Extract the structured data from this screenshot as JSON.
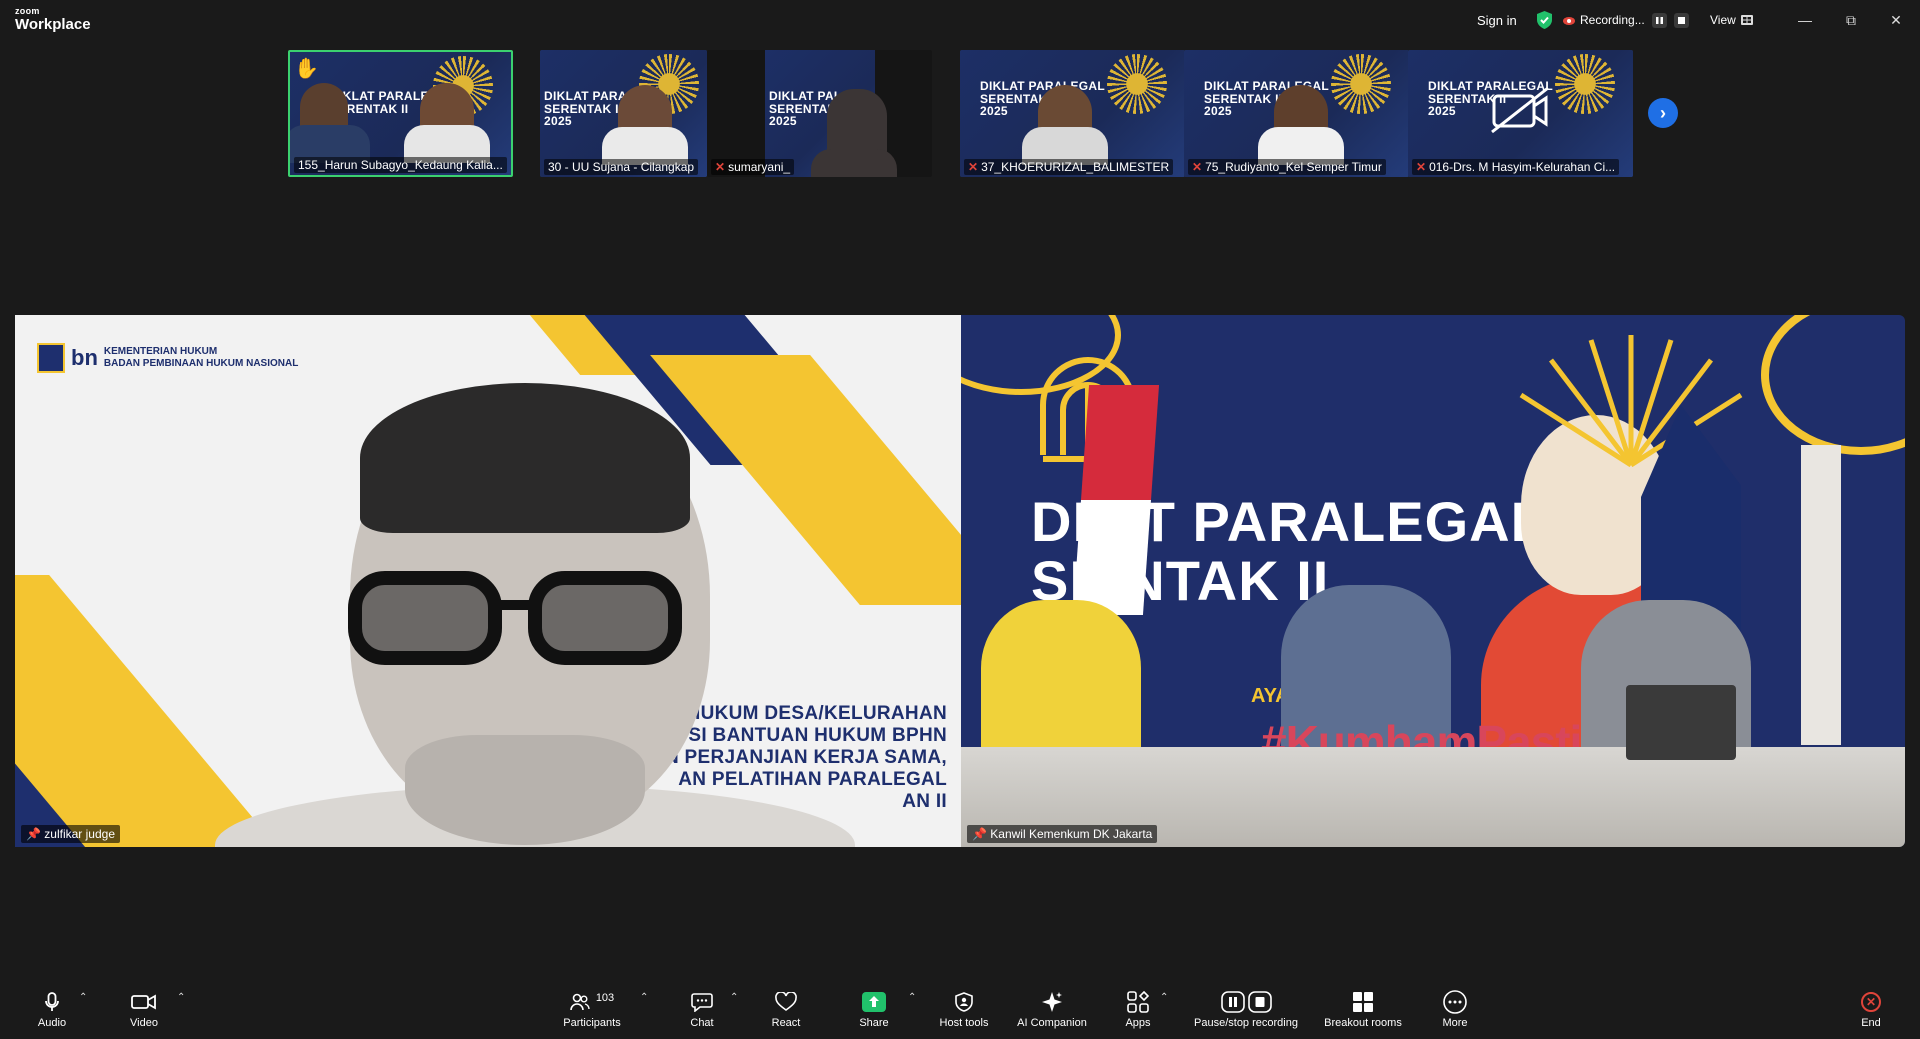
{
  "app": {
    "logo_top": "zoom",
    "logo_bottom": "Workplace",
    "sign_in": "Sign in",
    "recording": "Recording...",
    "view": "View"
  },
  "thumbnails": [
    {
      "name": "155_Harun Subagyo_Kedaung Kalia...",
      "muted": false,
      "active": true,
      "slide": "DIKLAT PARALEGAL\nSERENTAK II",
      "hand_raised": true
    },
    {
      "name": "30 - UU Sujana - Cilangkap",
      "muted": false,
      "active": false,
      "slide": "DIKLAT PARA\nSERENTAK II\n2025"
    },
    {
      "name": "sumaryani_",
      "muted": true,
      "active": false,
      "slide": "DIKLAT PAI\nSERENTAK\n2025"
    },
    {
      "name": "37_KHOERURIZAL_BALIMESTER",
      "muted": true,
      "active": false,
      "slide": "DIKLAT PARALEGAL\nSERENTAK II\n2025"
    },
    {
      "name": "75_Rudiyanto_Kel Semper Timur",
      "muted": true,
      "active": false,
      "slide": "DIKLAT PARALEGAL\nSERENTAK II\n2025"
    },
    {
      "name": "016-Drs. M Hasyim-Kelurahan Ci...",
      "muted": true,
      "active": false,
      "slide": "DIKLAT PARALEGAL\nSERENTAK II\n2025",
      "video_off": true
    }
  ],
  "main_left": {
    "participant": "zulfikar judge",
    "logo_line1": "KEMENTERIAN HUKUM",
    "logo_line2": "BADAN PEMBINAAN HUKUM NASIONAL",
    "logo_mark": "bn",
    "slide_lines": [
      "N HUKUM DESA/KELURAHAN",
      "SI BANTUAN HUKUM BPHN",
      "AN PERJANJIAN KERJA SAMA,",
      "AN PELATIHAN PARALEGAL",
      "AN II"
    ]
  },
  "main_right": {
    "participant": "Kanwil Kemenkum DK Jakarta",
    "title_line1": "DI  AT PARALEGAL",
    "title_line2": "SE  NTAK II",
    "subtitle": "AYAH KE          UM",
    "hashtag": "#KumhamPasti"
  },
  "toolbar": {
    "audio": "Audio",
    "video": "Video",
    "participants": "Participants",
    "participants_count": "103",
    "chat": "Chat",
    "react": "React",
    "share": "Share",
    "host_tools": "Host tools",
    "ai_companion": "AI Companion",
    "apps": "Apps",
    "pause_recording": "Pause/stop recording",
    "breakout_rooms": "Breakout rooms",
    "more": "More",
    "end": "End"
  },
  "colors": {
    "background": "#1a1a1a",
    "active_border": "#3bd16f",
    "share_green": "#21c16b",
    "end_red": "#e0443a",
    "nav_blue": "#1f6fe5",
    "slide_navy": "#1e2f6e",
    "slide_yellow": "#f4c531"
  }
}
